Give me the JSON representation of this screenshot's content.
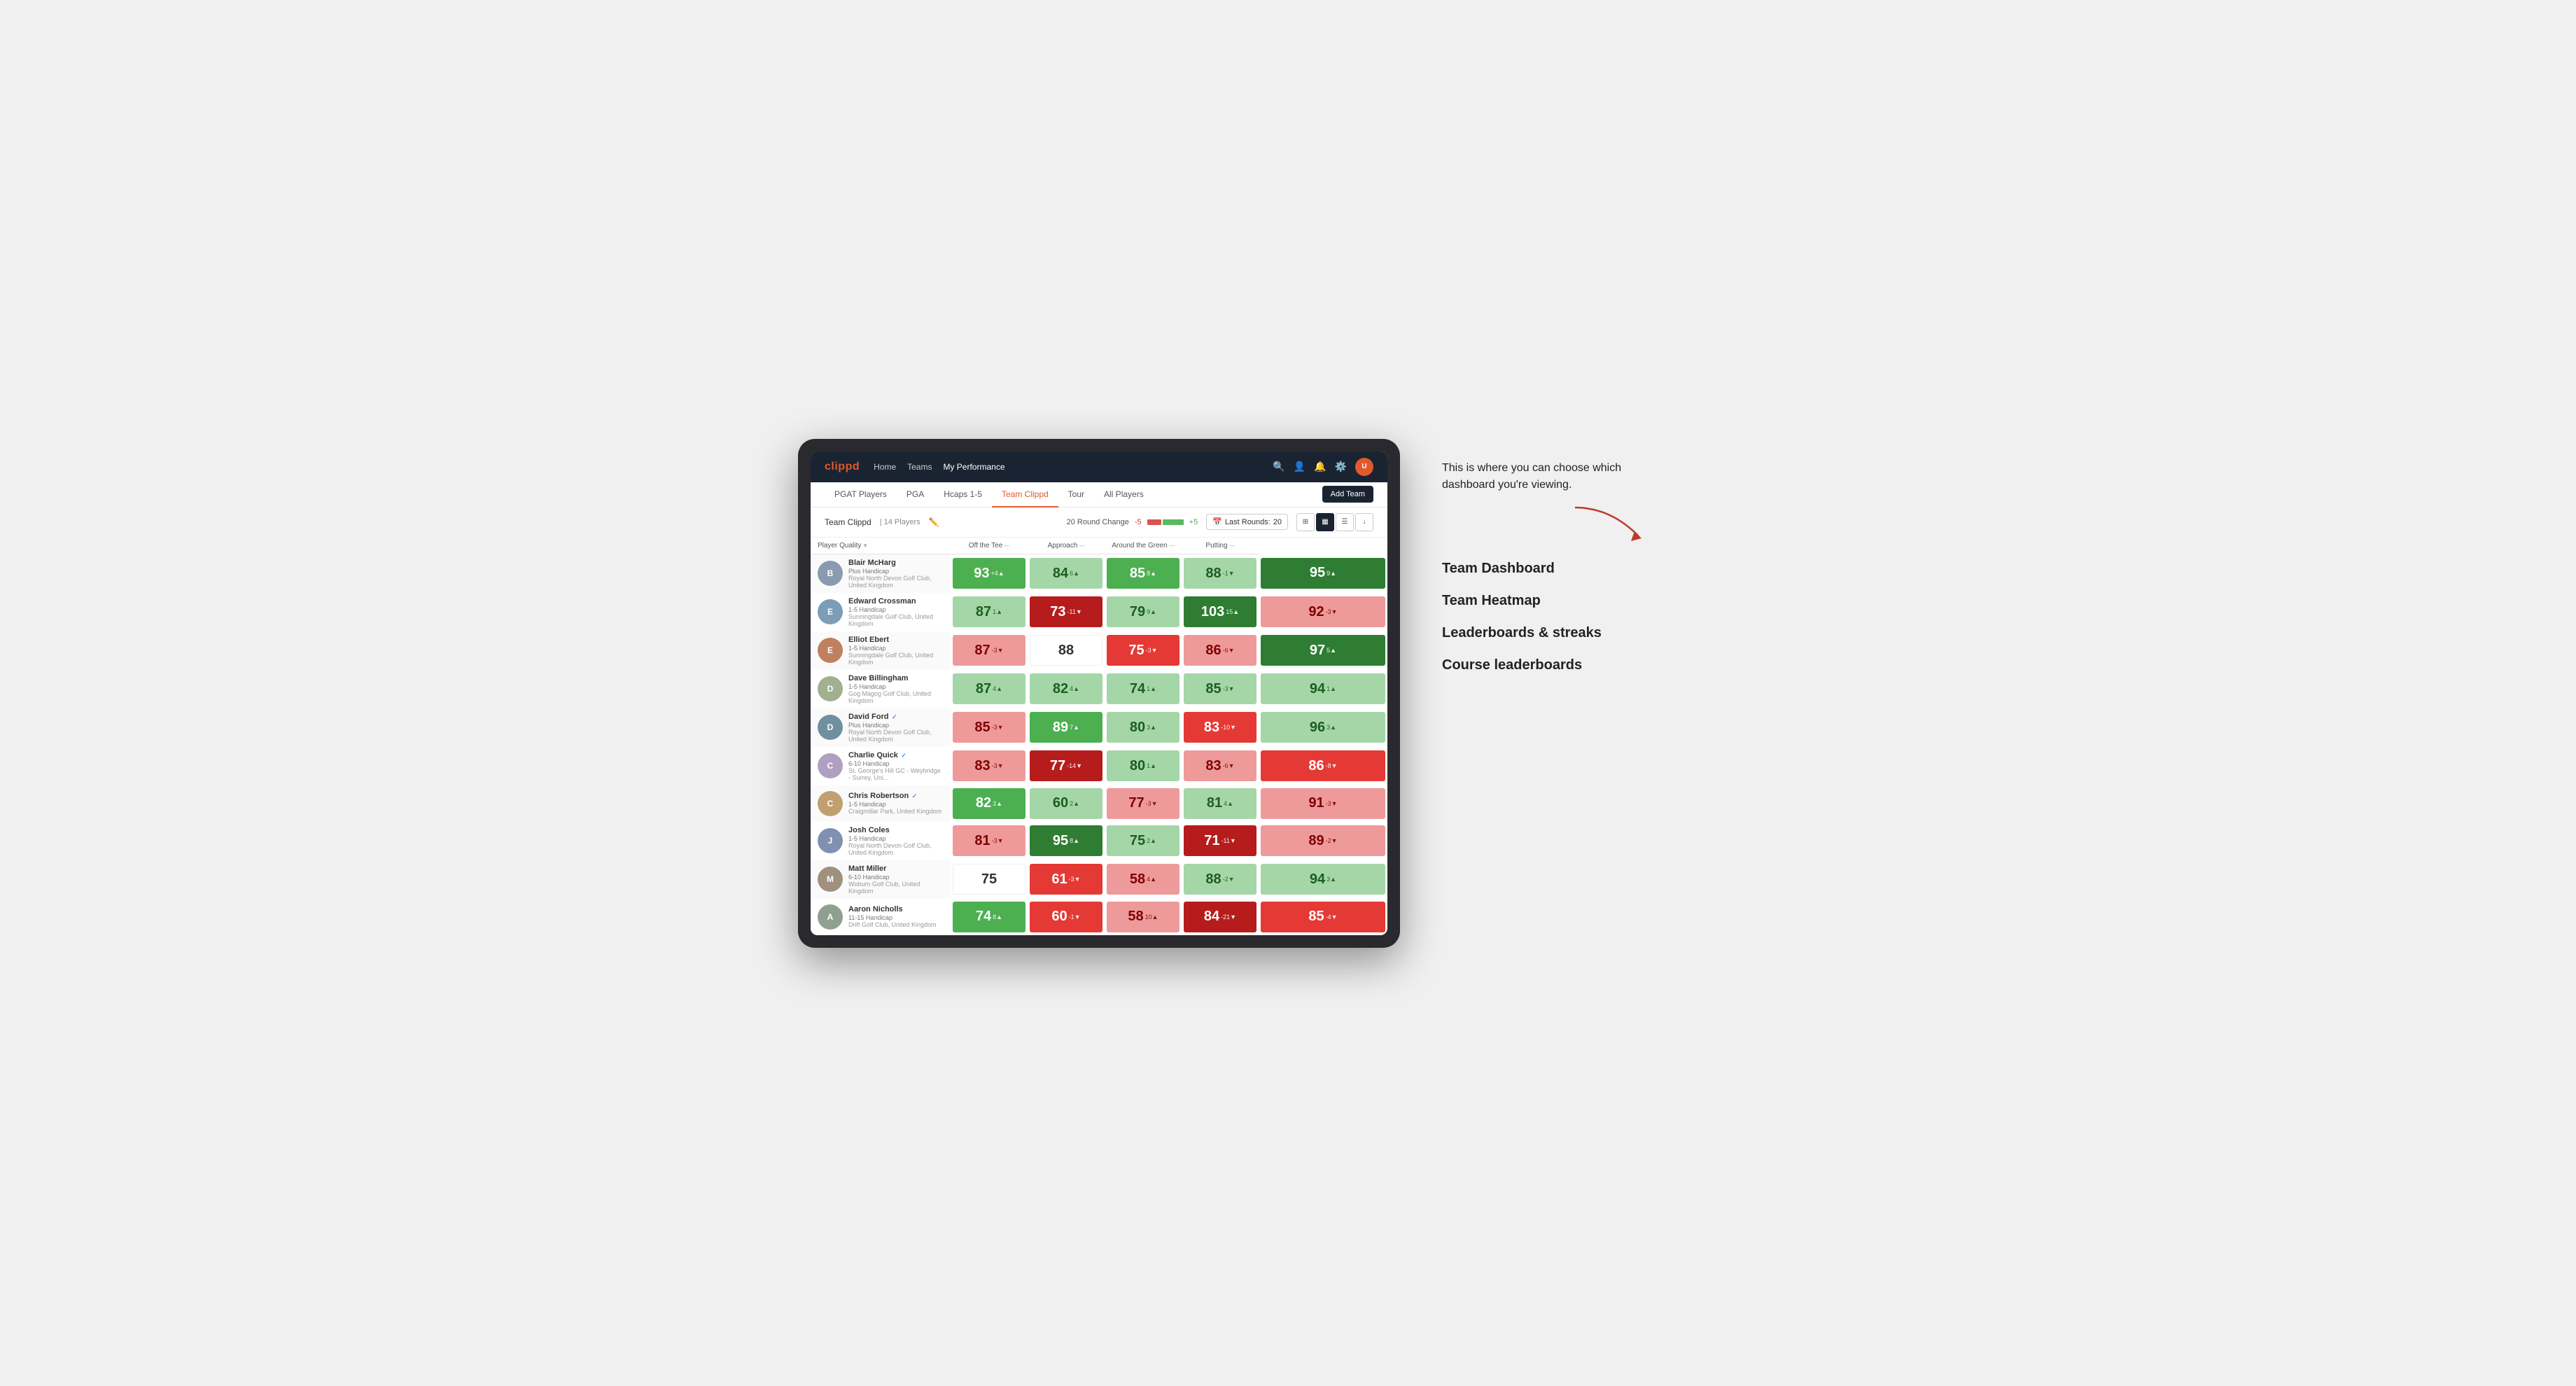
{
  "annotation": {
    "tooltip": "This is where you can choose which dashboard you're viewing.",
    "arrow_direction": "right-down",
    "menu_items": [
      {
        "label": "Team Dashboard"
      },
      {
        "label": "Team Heatmap"
      },
      {
        "label": "Leaderboards & streaks"
      },
      {
        "label": "Course leaderboards"
      }
    ]
  },
  "nav": {
    "logo": "clippd",
    "links": [
      {
        "label": "Home",
        "active": false
      },
      {
        "label": "Teams",
        "active": false
      },
      {
        "label": "My Performance",
        "active": true
      }
    ],
    "icons": [
      "search",
      "person",
      "bell",
      "settings",
      "avatar"
    ]
  },
  "tabs": [
    {
      "label": "PGAT Players",
      "active": false
    },
    {
      "label": "PGA",
      "active": false
    },
    {
      "label": "Hcaps 1-5",
      "active": false
    },
    {
      "label": "Team Clippd",
      "active": true
    },
    {
      "label": "Tour",
      "active": false
    },
    {
      "label": "All Players",
      "active": false
    }
  ],
  "add_team_label": "Add Team",
  "team": {
    "name": "Team Clippd",
    "separator": "|",
    "count": "14 Players",
    "round_change_label": "20 Round Change",
    "change_minus": "-5",
    "change_plus": "+5",
    "last_rounds_label": "Last Rounds:",
    "last_rounds_value": "20"
  },
  "columns": [
    {
      "label": "Player Quality",
      "sortable": true
    },
    {
      "label": "Off the Tee",
      "sortable": true
    },
    {
      "label": "Approach",
      "sortable": true
    },
    {
      "label": "Around the Green",
      "sortable": true
    },
    {
      "label": "Putting",
      "sortable": true
    }
  ],
  "players": [
    {
      "name": "Blair McHarg",
      "handicap": "Plus Handicap",
      "club": "Royal North Devon Golf Club, United Kingdom",
      "avatar_letter": "B",
      "avatar_bg": "#8a9bb0",
      "scores": [
        {
          "value": 93,
          "change": "+4",
          "direction": "up",
          "color": "green"
        },
        {
          "value": 84,
          "change": "6",
          "direction": "up",
          "color": "light-green"
        },
        {
          "value": 85,
          "change": "8",
          "direction": "up",
          "color": "green"
        },
        {
          "value": 88,
          "change": "-1",
          "direction": "down",
          "color": "light-green"
        },
        {
          "value": 95,
          "change": "9",
          "direction": "up",
          "color": "dark-green"
        }
      ]
    },
    {
      "name": "Edward Crossman",
      "handicap": "1-5 Handicap",
      "club": "Sunningdale Golf Club, United Kingdom",
      "avatar_letter": "E",
      "avatar_bg": "#7b9db5",
      "scores": [
        {
          "value": 87,
          "change": "1",
          "direction": "up",
          "color": "light-green"
        },
        {
          "value": 73,
          "change": "-11",
          "direction": "down",
          "color": "dark-red"
        },
        {
          "value": 79,
          "change": "9",
          "direction": "up",
          "color": "light-green"
        },
        {
          "value": 103,
          "change": "15",
          "direction": "up",
          "color": "dark-green"
        },
        {
          "value": 92,
          "change": "-3",
          "direction": "down",
          "color": "light-red"
        }
      ]
    },
    {
      "name": "Elliot Ebert",
      "handicap": "1-5 Handicap",
      "club": "Sunningdale Golf Club, United Kingdom",
      "avatar_letter": "E",
      "avatar_bg": "#c08060",
      "scores": [
        {
          "value": 87,
          "change": "-3",
          "direction": "down",
          "color": "light-red"
        },
        {
          "value": 88,
          "change": "",
          "direction": "",
          "color": "white-bg"
        },
        {
          "value": 75,
          "change": "-3",
          "direction": "down",
          "color": "red"
        },
        {
          "value": 86,
          "change": "-6",
          "direction": "down",
          "color": "light-red"
        },
        {
          "value": 97,
          "change": "5",
          "direction": "up",
          "color": "dark-green"
        }
      ]
    },
    {
      "name": "Dave Billingham",
      "handicap": "1-5 Handicap",
      "club": "Gog Magog Golf Club, United Kingdom",
      "avatar_letter": "D",
      "avatar_bg": "#a0b090",
      "scores": [
        {
          "value": 87,
          "change": "4",
          "direction": "up",
          "color": "light-green"
        },
        {
          "value": 82,
          "change": "4",
          "direction": "up",
          "color": "light-green"
        },
        {
          "value": 74,
          "change": "1",
          "direction": "up",
          "color": "light-green"
        },
        {
          "value": 85,
          "change": "-3",
          "direction": "down",
          "color": "light-green"
        },
        {
          "value": 94,
          "change": "1",
          "direction": "up",
          "color": "light-green"
        }
      ]
    },
    {
      "name": "David Ford",
      "handicap": "Plus Handicap",
      "club": "Royal North Devon Golf Club, United Kingdom",
      "verified": true,
      "avatar_letter": "D",
      "avatar_bg": "#7090a0",
      "scores": [
        {
          "value": 85,
          "change": "-3",
          "direction": "down",
          "color": "light-red"
        },
        {
          "value": 89,
          "change": "7",
          "direction": "up",
          "color": "green"
        },
        {
          "value": 80,
          "change": "3",
          "direction": "up",
          "color": "light-green"
        },
        {
          "value": 83,
          "change": "-10",
          "direction": "down",
          "color": "red"
        },
        {
          "value": 96,
          "change": "3",
          "direction": "up",
          "color": "light-green"
        }
      ]
    },
    {
      "name": "Charlie Quick",
      "handicap": "6-10 Handicap",
      "club": "St. George's Hill GC - Weybridge - Surrey, Uni...",
      "verified": true,
      "avatar_letter": "C",
      "avatar_bg": "#b0a0c0",
      "scores": [
        {
          "value": 83,
          "change": "-3",
          "direction": "down",
          "color": "light-red"
        },
        {
          "value": 77,
          "change": "-14",
          "direction": "down",
          "color": "dark-red"
        },
        {
          "value": 80,
          "change": "1",
          "direction": "up",
          "color": "light-green"
        },
        {
          "value": 83,
          "change": "-6",
          "direction": "down",
          "color": "light-red"
        },
        {
          "value": 86,
          "change": "-8",
          "direction": "down",
          "color": "red"
        }
      ]
    },
    {
      "name": "Chris Robertson",
      "handicap": "1-5 Handicap",
      "club": "Craigmillar Park, United Kingdom",
      "verified": true,
      "avatar_letter": "C",
      "avatar_bg": "#c0a070",
      "scores": [
        {
          "value": 82,
          "change": "3",
          "direction": "up",
          "color": "green"
        },
        {
          "value": 60,
          "change": "2",
          "direction": "up",
          "color": "light-green"
        },
        {
          "value": 77,
          "change": "-3",
          "direction": "down",
          "color": "light-red"
        },
        {
          "value": 81,
          "change": "4",
          "direction": "up",
          "color": "light-green"
        },
        {
          "value": 91,
          "change": "-3",
          "direction": "down",
          "color": "light-red"
        }
      ]
    },
    {
      "name": "Josh Coles",
      "handicap": "1-5 Handicap",
      "club": "Royal North Devon Golf Club, United Kingdom",
      "avatar_letter": "J",
      "avatar_bg": "#8090b0",
      "scores": [
        {
          "value": 81,
          "change": "-3",
          "direction": "down",
          "color": "light-red"
        },
        {
          "value": 95,
          "change": "8",
          "direction": "up",
          "color": "dark-green"
        },
        {
          "value": 75,
          "change": "2",
          "direction": "up",
          "color": "light-green"
        },
        {
          "value": 71,
          "change": "-11",
          "direction": "down",
          "color": "dark-red"
        },
        {
          "value": 89,
          "change": "-2",
          "direction": "down",
          "color": "light-red"
        }
      ]
    },
    {
      "name": "Matt Miller",
      "handicap": "6-10 Handicap",
      "club": "Woburn Golf Club, United Kingdom",
      "avatar_letter": "M",
      "avatar_bg": "#a09080",
      "scores": [
        {
          "value": 75,
          "change": "",
          "direction": "",
          "color": "white-bg"
        },
        {
          "value": 61,
          "change": "-3",
          "direction": "down",
          "color": "red"
        },
        {
          "value": 58,
          "change": "4",
          "direction": "up",
          "color": "light-red"
        },
        {
          "value": 88,
          "change": "-2",
          "direction": "down",
          "color": "light-green"
        },
        {
          "value": 94,
          "change": "3",
          "direction": "up",
          "color": "light-green"
        }
      ]
    },
    {
      "name": "Aaron Nicholls",
      "handicap": "11-15 Handicap",
      "club": "Drift Golf Club, United Kingdom",
      "avatar_letter": "A",
      "avatar_bg": "#90a090",
      "scores": [
        {
          "value": 74,
          "change": "8",
          "direction": "up",
          "color": "green"
        },
        {
          "value": 60,
          "change": "-1",
          "direction": "down",
          "color": "red"
        },
        {
          "value": 58,
          "change": "10",
          "direction": "up",
          "color": "light-red"
        },
        {
          "value": 84,
          "change": "-21",
          "direction": "down",
          "color": "dark-red"
        },
        {
          "value": 85,
          "change": "-4",
          "direction": "down",
          "color": "red"
        }
      ]
    }
  ]
}
